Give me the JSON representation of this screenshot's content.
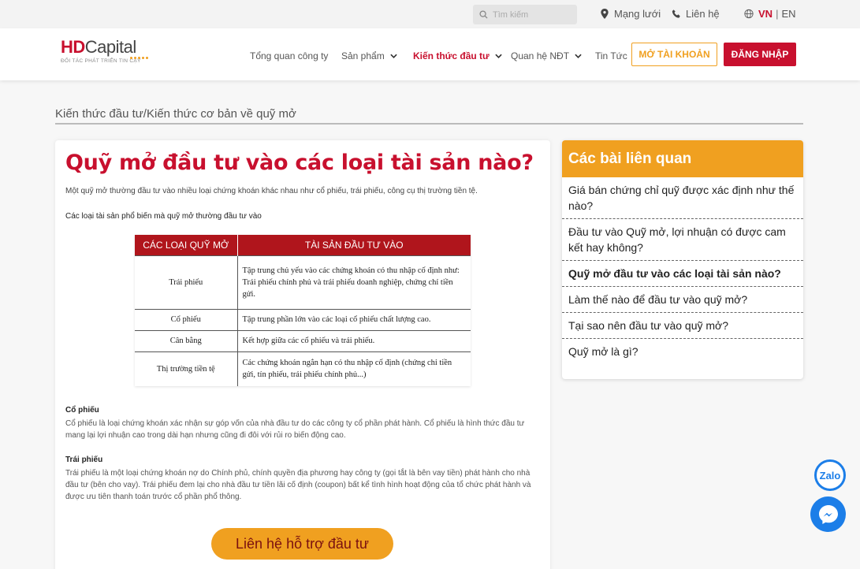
{
  "topbar": {
    "search_placeholder": "Tìm kiếm",
    "network": "Mạng lưới",
    "contact": "Liên hệ",
    "lang_vn": "VN",
    "lang_sep": "|",
    "lang_en": "EN"
  },
  "logo": {
    "hd": "HD",
    "capital": "Capital",
    "tagline": "ĐỐI TÁC PHÁT TRIỂN TIN CẬY"
  },
  "nav": {
    "overview": "Tổng quan công ty",
    "products": "Sản phẩm",
    "knowledge": "Kiến thức đầu tư",
    "investor_relations": "Quan hệ NĐT",
    "news": "Tin Tức",
    "open_account": "MỞ TÀI KHOẢN",
    "login": "ĐĂNG NHẬP"
  },
  "breadcrumb": "Kiến thức đầu tư/Kiến thức cơ bản về quỹ mở",
  "article": {
    "title": "Quỹ mở đầu tư vào các loại tài sản nào?",
    "intro": "Một quỹ mở thường đầu tư vào nhiều loại chứng khoán khác nhau như cổ phiếu, trái phiếu, công cụ thị trường tiền tệ.",
    "subheading": "Các loại tài sản phổ biến mà quỹ mở thường đầu tư vào",
    "table": {
      "headers": [
        "CÁC LOẠI QUỸ MỞ",
        "TÀI SẢN ĐẦU TƯ VÀO"
      ],
      "rows": [
        [
          "Trái phiếu",
          "Tập trung chủ yếu vào các chứng khoán có thu nhập cố định như: Trái phiếu chính phủ và trái phiếu doanh nghiệp, chứng chỉ tiền gửi."
        ],
        [
          "Cổ phiếu",
          "Tập trung phần lớn vào các loại cổ phiếu chất lượng cao."
        ],
        [
          "Cân bằng",
          "Kết hợp giữa các cổ phiếu và trái phiếu."
        ],
        [
          "Thị trường tiền tệ",
          "Các chứng khoán ngắn hạn có thu nhập cố định (chứng chỉ tiền gửi, tín phiếu, trái phiếu chính phủ...)"
        ]
      ]
    },
    "stock_heading": "Cổ phiếu",
    "stock_text": "Cổ phiếu là loại chứng khoán xác nhận sự góp vốn của nhà đầu tư do các công ty cổ phần phát hành. Cổ phiếu là hình thức đầu tư mang lại lợi nhuận cao trong dài hạn nhưng cũng đi đôi với rủi ro biến động cao.",
    "bond_heading": "Trái phiếu",
    "bond_text": "Trái phiếu là một loại chứng khoán nợ do Chính phủ, chính quyền địa phương hay công ty (gọi tắt là bên vay tiền) phát hành cho nhà đầu tư (bên cho vay). Trái phiếu đem lại cho nhà đầu tư tiền lãi cố định (coupon) bất kể tình hình hoạt động của tổ chức phát hành và được ưu tiên thanh toán trước cổ phần phổ thông.",
    "support_button": "Liên hệ hỗ trợ đầu tư"
  },
  "related": {
    "title": "Các bài liên quan",
    "items": [
      "Giá bán chứng chỉ quỹ được xác định như thế nào?",
      "Đầu tư vào Quỹ mở, lợi nhuận có được cam kết hay không?",
      "Quỹ mở đầu tư vào các loại tài sản nào?",
      "Làm thế nào để đầu tư vào quỹ mở?",
      "Tại sao nên đầu tư vào quỹ mở?",
      "Quỹ mở là gì?"
    ]
  },
  "floating": {
    "zalo": "Zalo"
  },
  "colors": {
    "brand_red": "#c8102e",
    "accent_orange": "#f0a020",
    "messenger_blue": "#1c7ee8"
  }
}
